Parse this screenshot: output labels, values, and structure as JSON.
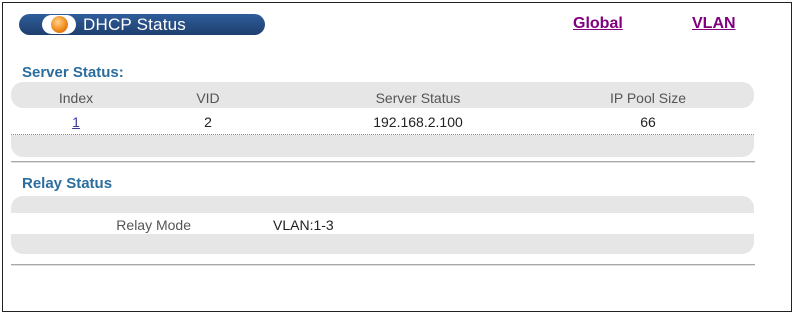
{
  "header": {
    "title": "DHCP Status",
    "links": {
      "global": "Global",
      "vlan": "VLAN"
    }
  },
  "server_status": {
    "title": "Server Status:",
    "columns": [
      "Index",
      "VID",
      "Server Status",
      "IP Pool Size"
    ],
    "rows": [
      {
        "index": "1",
        "vid": "2",
        "server_status": "192.168.2.100",
        "ip_pool_size": "66"
      }
    ]
  },
  "relay_status": {
    "title": "Relay Status",
    "mode_label": "Relay Mode",
    "mode_value": "VLAN:1-3"
  },
  "colors": {
    "section_title": "#2a6d9e",
    "link_visited": "#800080",
    "title_pill": "#2f5d9a",
    "band_gray": "#e6e6e6",
    "orb": "#f08c1c"
  },
  "icons": {
    "title_orb": "orange-orb-icon"
  }
}
